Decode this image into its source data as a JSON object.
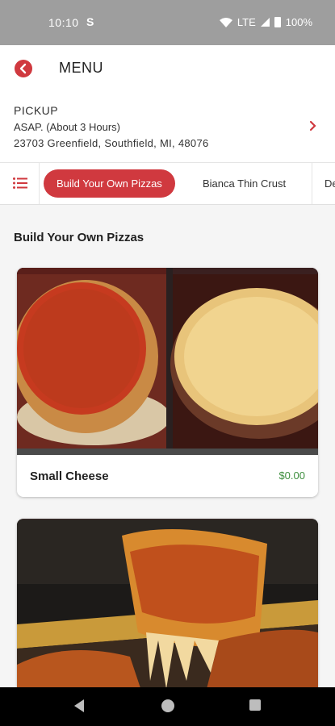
{
  "status_bar": {
    "time": "10:10",
    "app_icon": "S",
    "network": "LTE",
    "battery": "100%"
  },
  "header": {
    "title": "MENU"
  },
  "pickup": {
    "label": "PICKUP",
    "time": "ASAP. (About 3 Hours)",
    "address": "23703 Greenfield, Southfield, MI, 48076"
  },
  "tabs": [
    {
      "label": "Build Your Own Pizzas",
      "active": true
    },
    {
      "label": "Bianca Thin Crust",
      "active": false
    },
    {
      "label": "De",
      "active": false
    }
  ],
  "section": {
    "title": "Build Your Own Pizzas"
  },
  "items": [
    {
      "name": "Small Cheese",
      "price": "$0.00"
    }
  ],
  "colors": {
    "accent": "#d0393f",
    "price": "#3f8f3f"
  }
}
